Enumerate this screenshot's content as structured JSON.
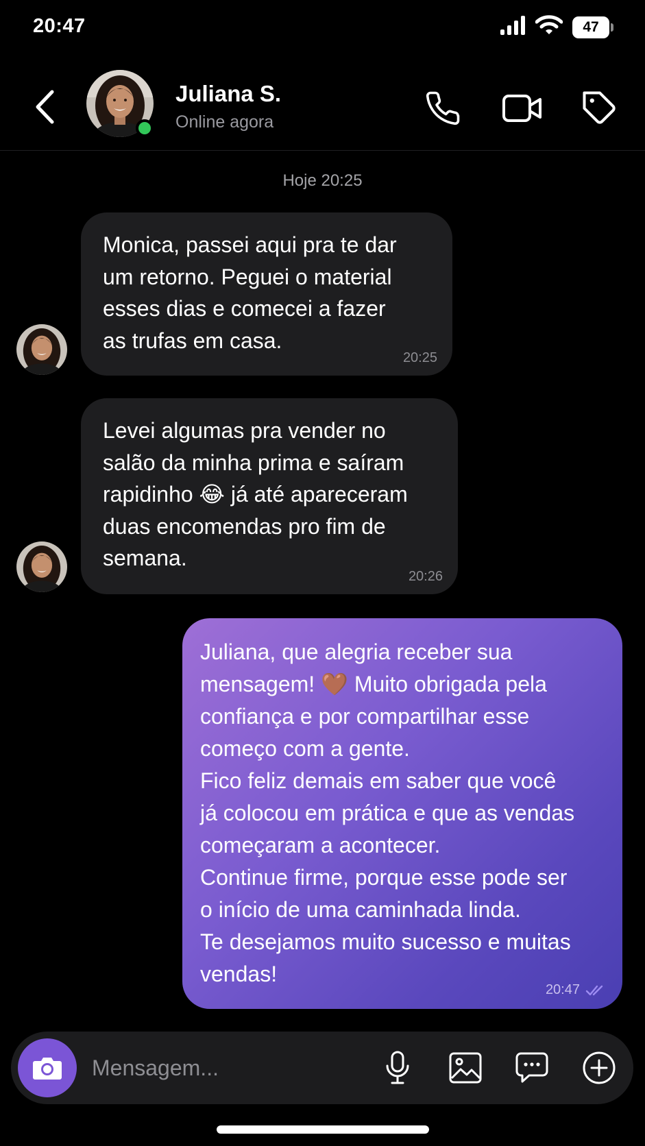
{
  "status_bar": {
    "time": "20:47",
    "battery_level": "47",
    "icons": [
      "cellular-signal-icon",
      "wifi-icon",
      "battery-icon"
    ]
  },
  "header": {
    "contact_name": "Juliana S.",
    "contact_status": "Online agora",
    "icons": [
      "back-chevron-icon",
      "phone-icon",
      "video-camera-icon",
      "tag-icon"
    ]
  },
  "chat": {
    "date_separator": "Hoje 20:25",
    "messages": [
      {
        "direction": "incoming",
        "text": "Monica, passei aqui pra te dar\num retorno. Peguei o material\nesses dias e comecei a fazer\nas trufas em casa.",
        "time": "20:25"
      },
      {
        "direction": "incoming",
        "text": "Levei algumas pra vender no\nsalão da minha prima e saíram\nrapidinho 😂 já até apareceram\nduas encomendas pro fim de\nsemana.",
        "time": "20:26"
      },
      {
        "direction": "outgoing",
        "text": "Juliana, que alegria receber sua\nmensagem! 🤎 Muito obrigada pela\nconfiança e por compartilhar esse\ncomeço com a gente.\nFico feliz demais em saber que você\njá colocou em prática e que as vendas\ncomeçaram a acontecer.\nContinue firme, porque esse pode ser\no início de uma caminhada linda.\nTe desejamos muito sucesso e muitas\nvendas!",
        "time": "20:47",
        "read_receipt": "double-check-icon"
      }
    ]
  },
  "composer": {
    "placeholder": "Mensagem...",
    "value": "",
    "icons": [
      "camera-icon",
      "microphone-icon",
      "image-icon",
      "chat-bubble-icon",
      "plus-circle-icon"
    ]
  },
  "colors": {
    "background": "#000000",
    "incoming_bubble": "#1e1e20",
    "outgoing_gradient_start": "#9e6fd6",
    "outgoing_gradient_end": "#4a3fb2",
    "accent": "#7b55d6",
    "online": "#32c759"
  }
}
